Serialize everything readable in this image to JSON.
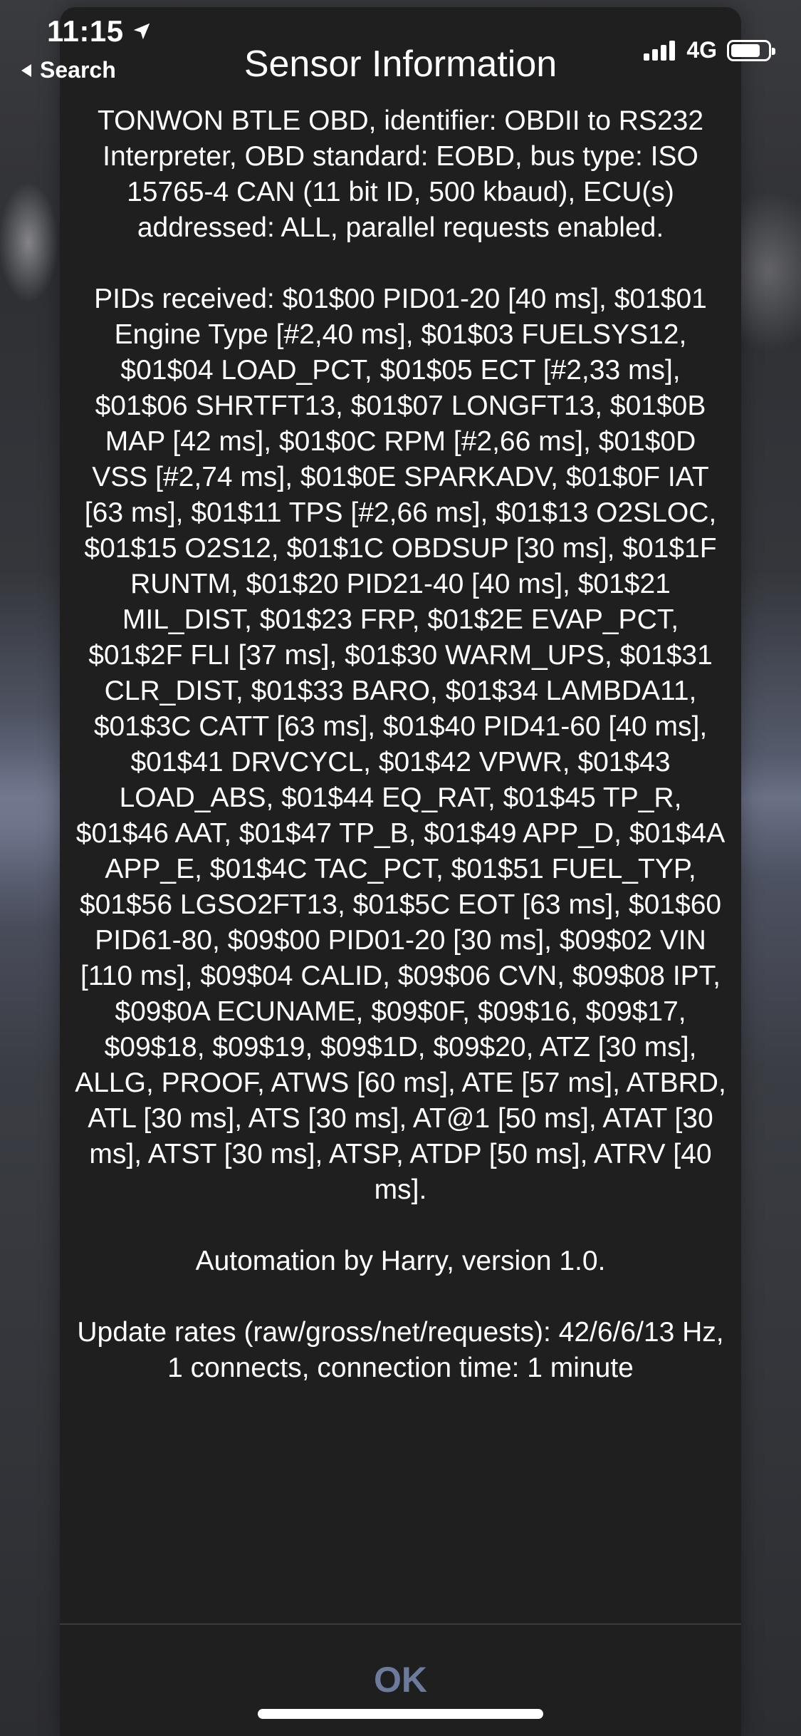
{
  "status_bar": {
    "time": "11:15",
    "back_label": "Search",
    "network": "4G",
    "location_icon": "location-arrow-icon",
    "battery_level": 0.8
  },
  "dialog": {
    "title": "Sensor Information",
    "paragraphs": [
      "TONWON BTLE OBD, identifier: OBDII to RS232 Interpreter, OBD standard: EOBD, bus type: ISO 15765-4 CAN (11 bit ID, 500 kbaud), ECU(s) addressed: ALL, parallel requests enabled.",
      "PIDs received: $01$00 PID01-20 [40 ms], $01$01 Engine Type [#2,40 ms], $01$03 FUELSYS12, $01$04 LOAD_PCT, $01$05 ECT [#2,33 ms], $01$06 SHRTFT13, $01$07 LONGFT13, $01$0B MAP [42 ms], $01$0C RPM [#2,66 ms], $01$0D VSS [#2,74 ms], $01$0E SPARKADV, $01$0F IAT [63 ms], $01$11 TPS [#2,66 ms], $01$13 O2SLOC, $01$15 O2S12, $01$1C OBDSUP [30 ms], $01$1F RUNTM, $01$20 PID21-40 [40 ms], $01$21 MIL_DIST, $01$23 FRP, $01$2E EVAP_PCT, $01$2F FLI [37 ms], $01$30 WARM_UPS, $01$31 CLR_DIST, $01$33 BARO, $01$34 LAMBDA11, $01$3C CATT [63 ms], $01$40 PID41-60 [40 ms], $01$41 DRVCYCL, $01$42 VPWR, $01$43 LOAD_ABS, $01$44 EQ_RAT, $01$45 TP_R, $01$46 AAT, $01$47 TP_B, $01$49 APP_D, $01$4A APP_E, $01$4C TAC_PCT, $01$51 FUEL_TYP, $01$56 LGSO2FT13, $01$5C EOT [63 ms], $01$60 PID61-80, $09$00 PID01-20 [30 ms], $09$02 VIN [110 ms], $09$04 CALID, $09$06 CVN, $09$08 IPT, $09$0A ECUNAME, $09$0F, $09$16, $09$17, $09$18, $09$19, $09$1D, $09$20, ATZ [30 ms], ALLG, PROOF, ATWS [60 ms], ATE [57 ms], ATBRD, ATL [30 ms], ATS [30 ms], AT@1 [50 ms], ATAT [30 ms], ATST [30 ms], ATSP, ATDP [50 ms], ATRV [40 ms].",
      "Automation by Harry, version 1.0.",
      "Update rates (raw/gross/net/requests): 42/6/6/13 Hz, 1 connects, connection time: 1 minute"
    ],
    "ok_label": "OK"
  },
  "colors": {
    "sheet_background": "#1f1f20",
    "text": "#ffffff",
    "ok_button": "#6c7a9c",
    "divider": "#3a3a3c"
  }
}
